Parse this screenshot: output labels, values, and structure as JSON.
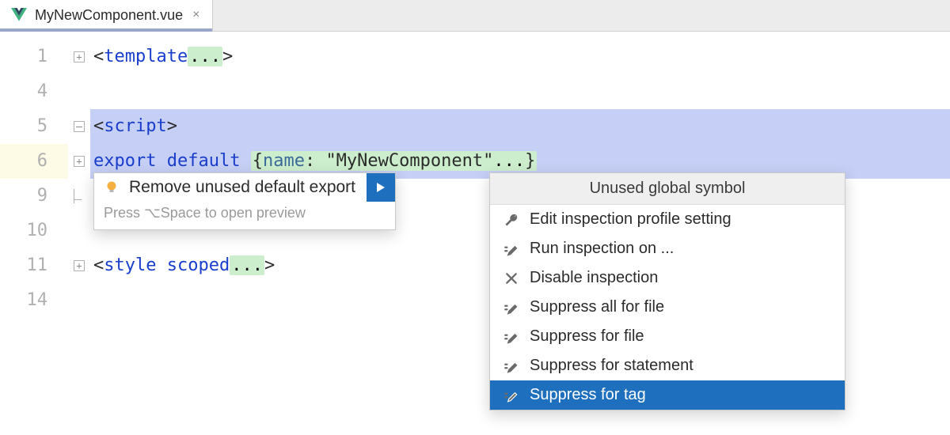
{
  "tab": {
    "name": "MyNewComponent.vue",
    "close_glyph": "×"
  },
  "gutter": {
    "lines": [
      "1",
      "4",
      "5",
      "6",
      "9",
      "10",
      "11",
      "14"
    ],
    "current_index": 3
  },
  "code": {
    "l1": {
      "open": "<",
      "tag": "template",
      "fold": "...",
      "close": ">"
    },
    "l5": {
      "open": "<",
      "tag": "script",
      "close": ">"
    },
    "l6": {
      "kw1": "export",
      "kw2": "default",
      "brace_open": "{",
      "prop": "name",
      "colon": ": ",
      "str": "\"MyNewComponent\"",
      "fold": "...",
      "brace_close": "}"
    },
    "l11": {
      "open": "<",
      "tag": "style",
      "attr": "scoped",
      "fold": "...",
      "close": ">"
    }
  },
  "intention": {
    "label": "Remove unused default export",
    "hint": "Press ⌥Space to open preview"
  },
  "submenu": {
    "title": "Unused global symbol",
    "items": [
      {
        "icon": "wrench",
        "label": "Edit inspection profile setting"
      },
      {
        "icon": "pencil",
        "label": "Run inspection on ..."
      },
      {
        "icon": "cross",
        "label": "Disable inspection"
      },
      {
        "icon": "pencil",
        "label": "Suppress all for file"
      },
      {
        "icon": "pencil",
        "label": "Suppress for file"
      },
      {
        "icon": "pencil",
        "label": "Suppress for statement"
      },
      {
        "icon": "pencil",
        "label": "Suppress for tag"
      }
    ],
    "selected_index": 6
  }
}
